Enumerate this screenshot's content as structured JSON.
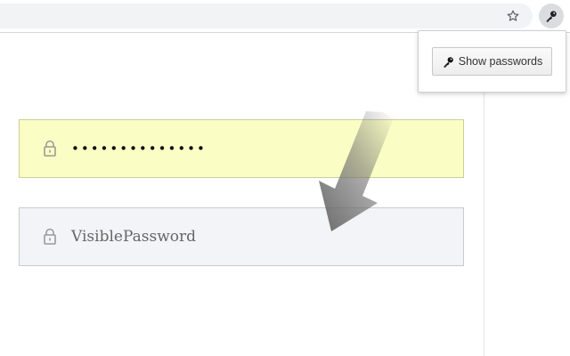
{
  "toolbar": {
    "star_icon": "star-outline-icon",
    "key_icon": "key-icon"
  },
  "popup": {
    "show_passwords_label": "Show passwords",
    "button_icon": "key-icon"
  },
  "fields": {
    "masked": {
      "value": "••••••••••••••",
      "icon": "lock-icon",
      "background": "#fbfec4"
    },
    "visible": {
      "value": "VisiblePassword",
      "icon": "lock-icon",
      "background": "#f3f4f7"
    }
  },
  "colors": {
    "arrow": "#6b6b6b",
    "key_button_bg": "#dadce0"
  }
}
